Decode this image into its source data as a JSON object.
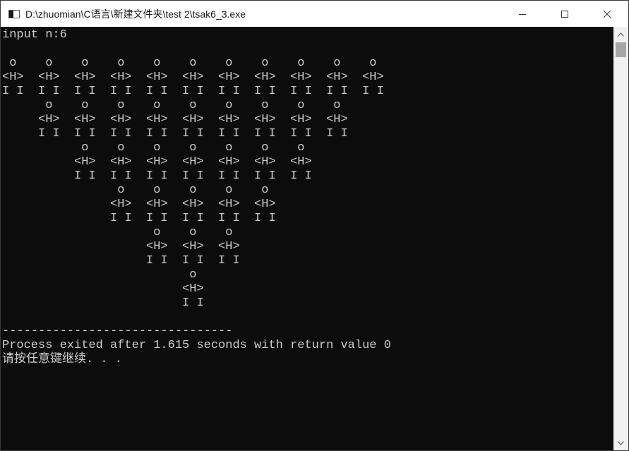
{
  "window": {
    "title": "D:\\zhuomian\\C语言\\新建文件夹\\test 2\\tsak6_3.exe",
    "minimize_icon": "minimize-icon",
    "maximize_icon": "maximize-icon",
    "close_icon": "close-icon"
  },
  "console": {
    "lines": [
      "input n:6",
      "",
      " o    o    o    o    o    o    o    o    o    o    o",
      "<H>  <H>  <H>  <H>  <H>  <H>  <H>  <H>  <H>  <H>  <H>",
      "I I  I I  I I  I I  I I  I I  I I  I I  I I  I I  I I",
      "      o    o    o    o    o    o    o    o    o",
      "     <H>  <H>  <H>  <H>  <H>  <H>  <H>  <H>  <H>",
      "     I I  I I  I I  I I  I I  I I  I I  I I  I I",
      "           o    o    o    o    o    o    o",
      "          <H>  <H>  <H>  <H>  <H>  <H>  <H>",
      "          I I  I I  I I  I I  I I  I I  I I",
      "                o    o    o    o    o",
      "               <H>  <H>  <H>  <H>  <H>",
      "               I I  I I  I I  I I  I I",
      "                     o    o    o",
      "                    <H>  <H>  <H>",
      "                    I I  I I  I I",
      "                          o",
      "                         <H>",
      "                         I I",
      "",
      "--------------------------------",
      "Process exited after 1.615 seconds with return value 0",
      "请按任意键继续. . ."
    ]
  },
  "colors": {
    "background": "#0c0c0c",
    "text": "#cccccc",
    "titlebar": "#ffffff"
  }
}
